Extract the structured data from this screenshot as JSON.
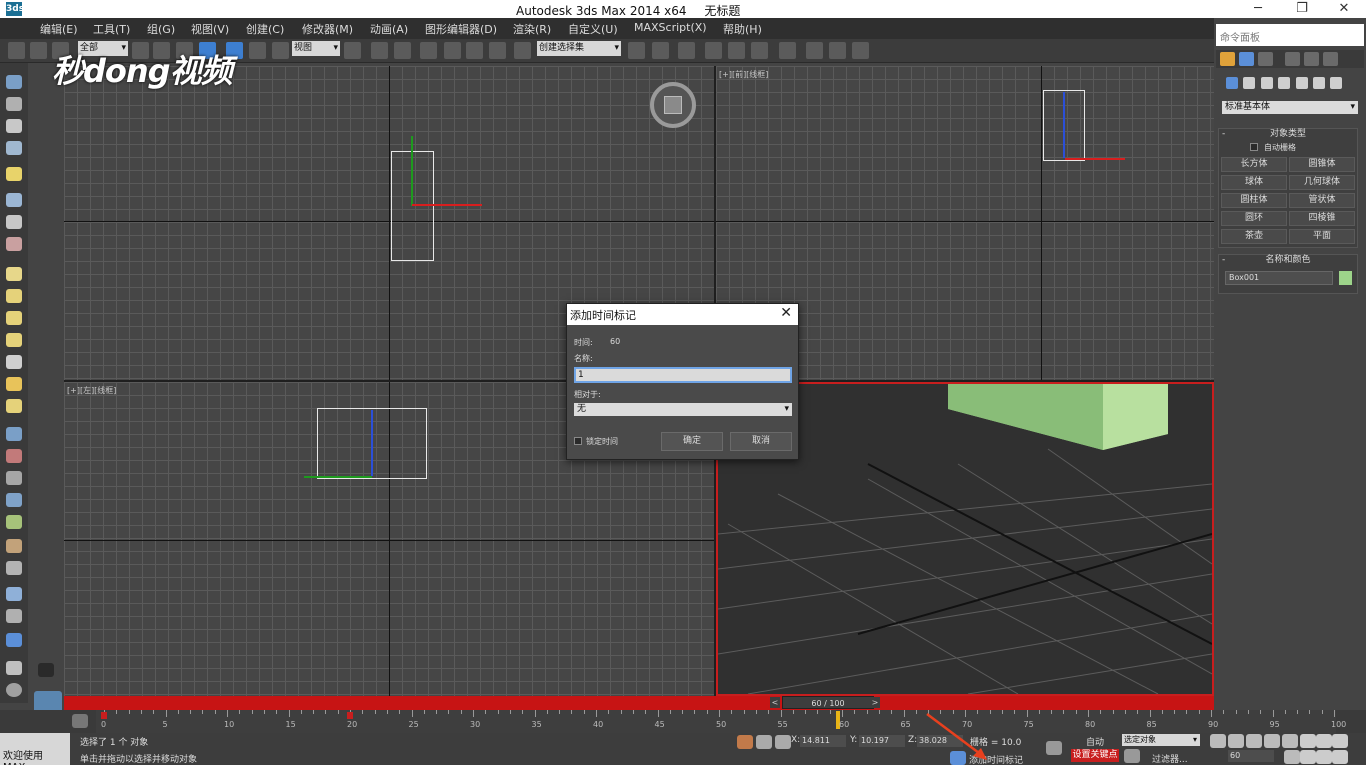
{
  "window": {
    "logo": "3ds",
    "title_app": "Autodesk 3ds Max  2014 x64",
    "title_doc": "无标题",
    "minimize": "─",
    "maximize": "❐",
    "close": "✕"
  },
  "menu": [
    "编辑(E)",
    "工具(T)",
    "组(G)",
    "视图(V)",
    "创建(C)",
    "修改器(M)",
    "动画(A)",
    "图形编辑器(D)",
    "渲染(R)",
    "自定义(U)",
    "MAXScript(X)",
    "帮助(H)"
  ],
  "toolbar": {
    "filter_value": "全部",
    "refcoord_value": "视图",
    "named_selection": "创建选择集"
  },
  "watermark": "秒dong视频",
  "viewports": {
    "top_right_label": "[+][前][线框]",
    "bottom_left_label": "[+][左][线框]"
  },
  "command_panel": {
    "header": "命令面板",
    "dropdown": "标准基本体",
    "object_type_title": "对象类型",
    "autogrid_label": "自动栅格",
    "buttons": [
      "长方体",
      "圆锥体",
      "球体",
      "几何球体",
      "圆柱体",
      "管状体",
      "圆环",
      "四棱锥",
      "茶壶",
      "平面"
    ],
    "name_color_title": "名称和颜色",
    "object_name": "Box001",
    "rollout_toggle": "-"
  },
  "dialog": {
    "title": "添加时间标记",
    "time_label": "时间:",
    "time_value": "60",
    "name_label": "名称:",
    "name_value": "1",
    "relative_label": "相对于:",
    "relative_value": "无",
    "lock_label": "锁定时间",
    "ok": "确定",
    "cancel": "取消",
    "close": "✕"
  },
  "timeline": {
    "slider_text": "60 / 100",
    "prev": "<",
    "next": ">",
    "ticks": [
      "0",
      "5",
      "10",
      "15",
      "20",
      "25",
      "30",
      "35",
      "40",
      "45",
      "50",
      "55",
      "60",
      "65",
      "70",
      "75",
      "80",
      "85",
      "90",
      "95",
      "100"
    ]
  },
  "status": {
    "max_label": "欢迎使用 MAX:",
    "selected_text": "选择了 1 个 对象",
    "hint_text": "单击并拖动以选择并移动对象",
    "x_label": "X:",
    "x_value": "14.811",
    "y_label": "Y:",
    "y_value": "10.197",
    "z_label": "Z:",
    "z_value": "38.028",
    "grid_text": "栅格 = 10.0",
    "add_time_tag": "添加时间标记",
    "auto_key": "自动",
    "selected_dropdown": "选定对象",
    "set_key": "设置关键点",
    "filters": "过滤器...",
    "frame_value": "60"
  },
  "colors": {
    "accent_red": "#c81e1e",
    "box_green": "#9dd48a",
    "axis_blue": "#2b4fd8",
    "axis_red": "#d81e1e",
    "axis_green": "#1e9a1e",
    "current_frame": "#e8b417"
  }
}
